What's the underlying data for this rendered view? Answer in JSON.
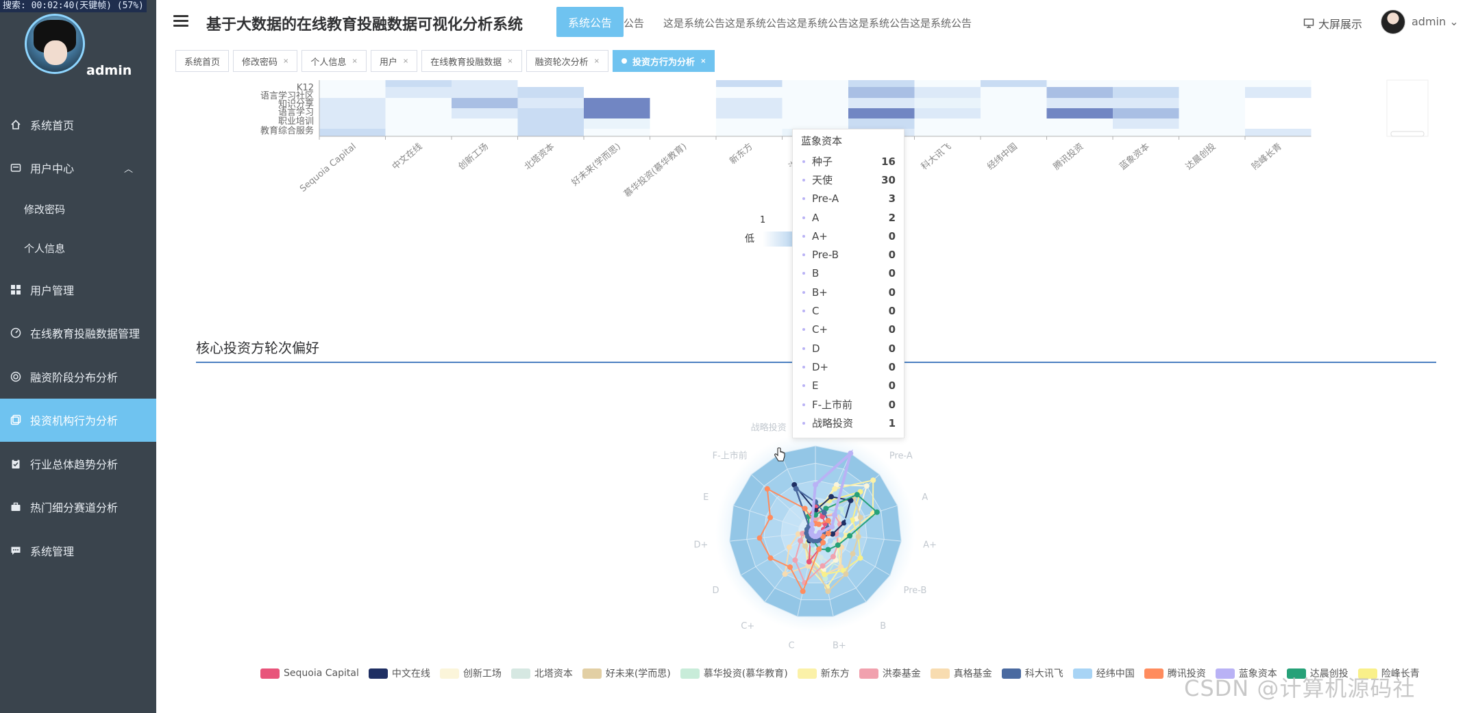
{
  "overlay": "搜索: 00:02:40(天键帧) (57%)",
  "sidebar": {
    "username": "admin",
    "items": [
      {
        "label": "系统首页",
        "icon": "home-icon"
      },
      {
        "label": "用户中心",
        "icon": "user-card-icon"
      },
      {
        "label": "修改密码"
      },
      {
        "label": "个人信息"
      },
      {
        "label": "用户管理",
        "icon": "grid-icon"
      },
      {
        "label": "在线教育投融数据管理",
        "icon": "gauge-icon"
      },
      {
        "label": "融资阶段分布分析",
        "icon": "lifebuoy-icon"
      },
      {
        "label": "投资机构行为分析",
        "icon": "copy-icon"
      },
      {
        "label": "行业总体趋势分析",
        "icon": "clipboard-icon"
      },
      {
        "label": "热门细分赛道分析",
        "icon": "briefcase-icon"
      },
      {
        "label": "系统管理",
        "icon": "chat-icon"
      }
    ]
  },
  "header": {
    "title": "基于大数据的在线教育投融数据可视化分析系统",
    "notice_button": "系统公告",
    "notice_suffix": "公告",
    "notice_text": "这是系统公告这是系统公告这是系统公告这是系统公告这是系统公告",
    "bigscreen": "大屏展示",
    "username": "admin"
  },
  "tabs": [
    "系统首页",
    "修改密码",
    "个人信息",
    "用户",
    "在线教育投融数据",
    "融资轮次分析",
    "投资方行为分析"
  ],
  "section": {
    "title": "核心投资方轮次偏好"
  },
  "chart_data": [
    {
      "type": "heatmap",
      "y_categories": [
        "教育综合服务",
        "职业培训",
        "语言学习",
        "知识分享",
        "语言学习社区",
        "K12"
      ],
      "x_categories": [
        "Sequoia Capital",
        "中文在线",
        "创新工场",
        "北塔资本",
        "好未来(学而思)",
        "慕华投资(慕华教育)",
        "新东方",
        "洪泰基金",
        "真格基金",
        "科大讯飞",
        "经纬中国",
        "腾讯投资",
        "蓝象资本",
        "达晨创投",
        "险峰长青"
      ],
      "visual_map": {
        "min_label": "低",
        "value": "1"
      }
    },
    {
      "type": "radar",
      "indicators": [
        "种子",
        "天使",
        "Pre-A",
        "A",
        "A+",
        "Pre-B",
        "B",
        "B+",
        "C",
        "C+",
        "D",
        "D+",
        "E",
        "F-上市前",
        "战略投资"
      ],
      "series": [
        {
          "name": "Sequoia Capital"
        },
        {
          "name": "中文在线"
        },
        {
          "name": "创新工场"
        },
        {
          "name": "北塔资本"
        },
        {
          "name": "好未来(学而思)"
        },
        {
          "name": "慕华投资(慕华教育)"
        },
        {
          "name": "新东方"
        },
        {
          "name": "洪泰基金"
        },
        {
          "name": "真格基金"
        },
        {
          "name": "科大讯飞"
        },
        {
          "name": "经纬中国"
        },
        {
          "name": "腾讯投资"
        },
        {
          "name": "蓝象资本",
          "values": [
            16,
            30,
            3,
            2,
            0,
            0,
            0,
            0,
            0,
            0,
            0,
            0,
            0,
            0,
            1
          ]
        },
        {
          "name": "达晨创投"
        },
        {
          "name": "险峰长青"
        }
      ],
      "legend_position": "bottom"
    }
  ],
  "tooltip": {
    "title": "蓝象资本",
    "rows": [
      {
        "name": "种子",
        "value": "16"
      },
      {
        "name": "天使",
        "value": "30"
      },
      {
        "name": "Pre-A",
        "value": "3"
      },
      {
        "name": "A",
        "value": "2"
      },
      {
        "name": "A+",
        "value": "0"
      },
      {
        "name": "Pre-B",
        "value": "0"
      },
      {
        "name": "B",
        "value": "0"
      },
      {
        "name": "B+",
        "value": "0"
      },
      {
        "name": "C",
        "value": "0"
      },
      {
        "name": "C+",
        "value": "0"
      },
      {
        "name": "D",
        "value": "0"
      },
      {
        "name": "D+",
        "value": "0"
      },
      {
        "name": "E",
        "value": "0"
      },
      {
        "name": "F-上市前",
        "value": "0"
      },
      {
        "name": "战略投资",
        "value": "1"
      }
    ]
  },
  "legend": [
    {
      "name": "Sequoia Capital",
      "color": "#e8547a"
    },
    {
      "name": "中文在线",
      "color": "#1f2f63"
    },
    {
      "name": "创新工场",
      "color": "#fbf5da"
    },
    {
      "name": "北塔资本",
      "color": "#d6e8e2"
    },
    {
      "name": "好未来(学而思)",
      "color": "#e2cfa4"
    },
    {
      "name": "慕华投资(慕华教育)",
      "color": "#c8ecd9"
    },
    {
      "name": "新东方",
      "color": "#fbf1a8"
    },
    {
      "name": "洪泰基金",
      "color": "#f1a1ae"
    },
    {
      "name": "真格基金",
      "color": "#f8dcb0"
    },
    {
      "name": "科大讯飞",
      "color": "#4a6aa0"
    },
    {
      "name": "经纬中国",
      "color": "#a8d4f5"
    },
    {
      "name": "腾讯投资",
      "color": "#ff8c5e"
    },
    {
      "name": "蓝象资本",
      "color": "#b9b2f5"
    },
    {
      "name": "达晨创投",
      "color": "#26a178"
    },
    {
      "name": "险峰长青",
      "color": "#f9f08a"
    }
  ],
  "watermark": "CSDN @计算机源码社"
}
